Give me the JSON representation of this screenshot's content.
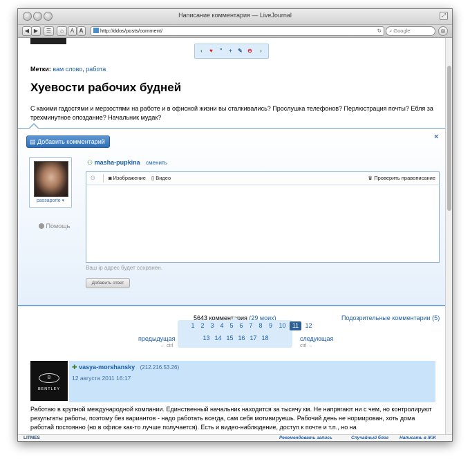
{
  "window": {
    "title": "Написание комментария — LiveJournal"
  },
  "browser": {
    "url": "http://ddos/posts/comment/",
    "search_placeholder": "Google",
    "font_small": "A",
    "font_large": "A"
  },
  "post": {
    "tags_label": "Метки:",
    "tag1": "вам слово",
    "tag_sep": ",",
    "tag2": "работа",
    "title": "Хуевости рабочих будней",
    "text": "С какими гадостями и мерзостями на работе и в офисной жизни вы сталкивались? Прослушка телефонов? Перлюстрация почты? Ебля за трехминутное опоздание? Начальник мудак?"
  },
  "comment_form": {
    "add_button": "Добавить комментарий",
    "close": "×",
    "userpic_name": "passaporte ▾",
    "help": "Помощь",
    "username": "masha-pupkina",
    "change_link": "сменить",
    "tool_image": "Изображение",
    "tool_video": "Видео",
    "spellcheck": "Проверить правописание",
    "text_value": "",
    "ip_notice": "Ваш ip адрес будет сохранен.",
    "submit": "Добавить ответ"
  },
  "comments": {
    "count_text": "5643 комментария",
    "mine_text": "(29 моих)",
    "suspicious": "Подозрительные комментарии (5)",
    "prev": "предыдущая",
    "prev_hint": "← ctrl",
    "next": "следующая",
    "next_hint": "ctrl →",
    "pages_row1": [
      "1",
      "2",
      "3",
      "4",
      "5",
      "6",
      "7",
      "8",
      "9",
      "10",
      "11",
      "12"
    ],
    "pages_row2": [
      "13",
      "14",
      "15",
      "16",
      "17",
      "18"
    ],
    "current_page": "11"
  },
  "first_comment": {
    "avatar_text": "BENTLEY",
    "author": "vasya-morshansky",
    "ip": "(212.216.53.26)",
    "date": "12 августа 2011 16:17",
    "text": "Работаю в крупной международной компании. Единственный начальник находится за тысячу км. Не напрягают ни с чем, но контролируют результаты работы, поэтому без вариантов - надо работать всегда, сам себя мотивируешь. Рабочий день не нормирован, хоть дома работай постоянно (но в офисе как-то лучше получается). Есть и видео-наблюдение, доступ к почте и т.п., но на"
  },
  "footer": {
    "logo": "LITMES",
    "recommend": "Рекомендовать запись",
    "random": "Случайный блог",
    "write": "Написать в ЖЖ"
  }
}
